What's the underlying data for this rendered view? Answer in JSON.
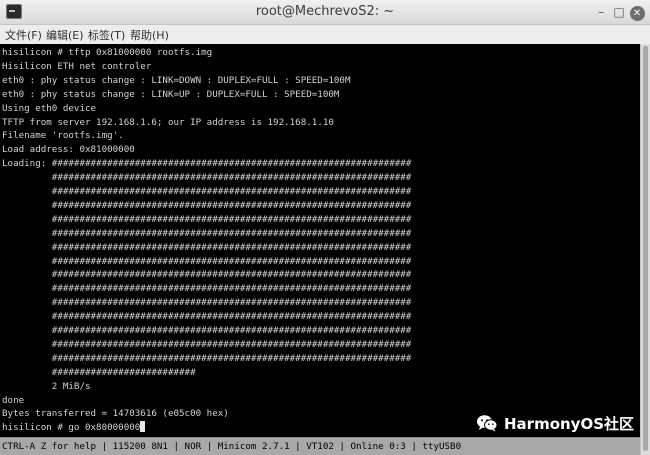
{
  "window": {
    "title": "root@MechrevoS2: ~",
    "controls": {
      "minimize_glyph": "–",
      "maximize_glyph": "□",
      "close_glyph": "✕"
    }
  },
  "menu": [
    {
      "label": "文件(F)"
    },
    {
      "label": "编辑(E)"
    },
    {
      "label": "标签(T)"
    },
    {
      "label": "帮助(H)"
    }
  ],
  "terminal": {
    "lines": [
      "hisilicon # tftp 0x81000000 rootfs.img",
      "Hisilicon ETH net controler",
      "eth0 : phy status change : LINK=DOWN : DUPLEX=FULL : SPEED=100M",
      "eth0 : phy status change : LINK=UP : DUPLEX=FULL : SPEED=100M",
      "Using eth0 device",
      "TFTP from server 192.168.1.6; our IP address is 192.168.1.10",
      "Filename 'rootfs.img'.",
      "Load address: 0x81000000",
      "Loading: #################################################################",
      "         #################################################################",
      "         #################################################################",
      "         #################################################################",
      "         #################################################################",
      "         #################################################################",
      "         #################################################################",
      "         #################################################################",
      "         #################################################################",
      "         #################################################################",
      "         #################################################################",
      "         #################################################################",
      "         #################################################################",
      "         #################################################################",
      "         #################################################################",
      "         ##########################",
      "         2 MiB/s",
      "done",
      "Bytes transferred = 14703616 (e05c00 hex)"
    ],
    "prompt_line": "hisilicon # go 0x80000000"
  },
  "status_bar": {
    "text": "CTRL-A Z for help | 115200 8N1 | NOR | Minicom 2.7.1 | VT102 | Online 0:3 | ttyUSB0"
  },
  "watermark": {
    "text": "HarmonyOS社区",
    "icon": "wechat-icon"
  },
  "colors": {
    "terminal_bg": "#000000",
    "terminal_fg": "#d2d2d2",
    "statusbar_bg": "#a8a8a8",
    "titlebar_bg": "#e4e4e4"
  }
}
